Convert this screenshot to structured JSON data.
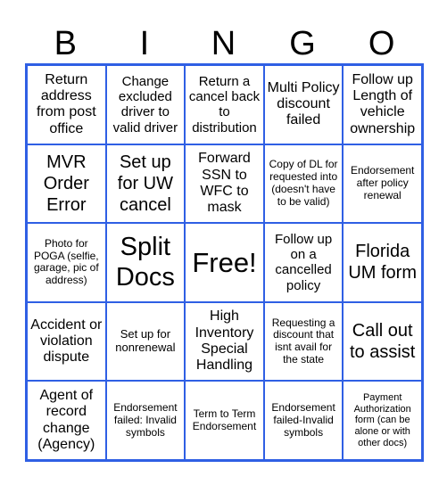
{
  "header": {
    "letters": [
      "B",
      "I",
      "N",
      "G",
      "O"
    ]
  },
  "border_color": "#2f5fe4",
  "cells": [
    [
      "Return address from post office",
      "Change excluded driver to valid driver",
      "Return a cancel back to distribution",
      "Multi Policy discount failed",
      "Follow up Length of vehicle ownership"
    ],
    [
      "MVR Order Error",
      "Set up for UW cancel",
      "Forward SSN to WFC to mask",
      "Copy of DL for requested into (doesn't have to be valid)",
      "Endorsement after policy renewal"
    ],
    [
      "Photo for POGA (selfie, garage, pic of address)",
      "Split Docs",
      "Free!",
      "Follow up on a cancelled policy",
      "Florida UM form"
    ],
    [
      "Accident or violation dispute",
      "Set up for nonrenewal",
      "High Inventory Special Handling",
      "Requesting a discount that isnt avail for the state",
      "Call out to assist"
    ],
    [
      "Agent of record change (Agency)",
      "Endorsement failed: Invalid symbols",
      "Term to Term Endorsement",
      "Endorsement failed-Invalid symbols",
      "Payment Authorization form (can be alone or with other docs)"
    ]
  ]
}
